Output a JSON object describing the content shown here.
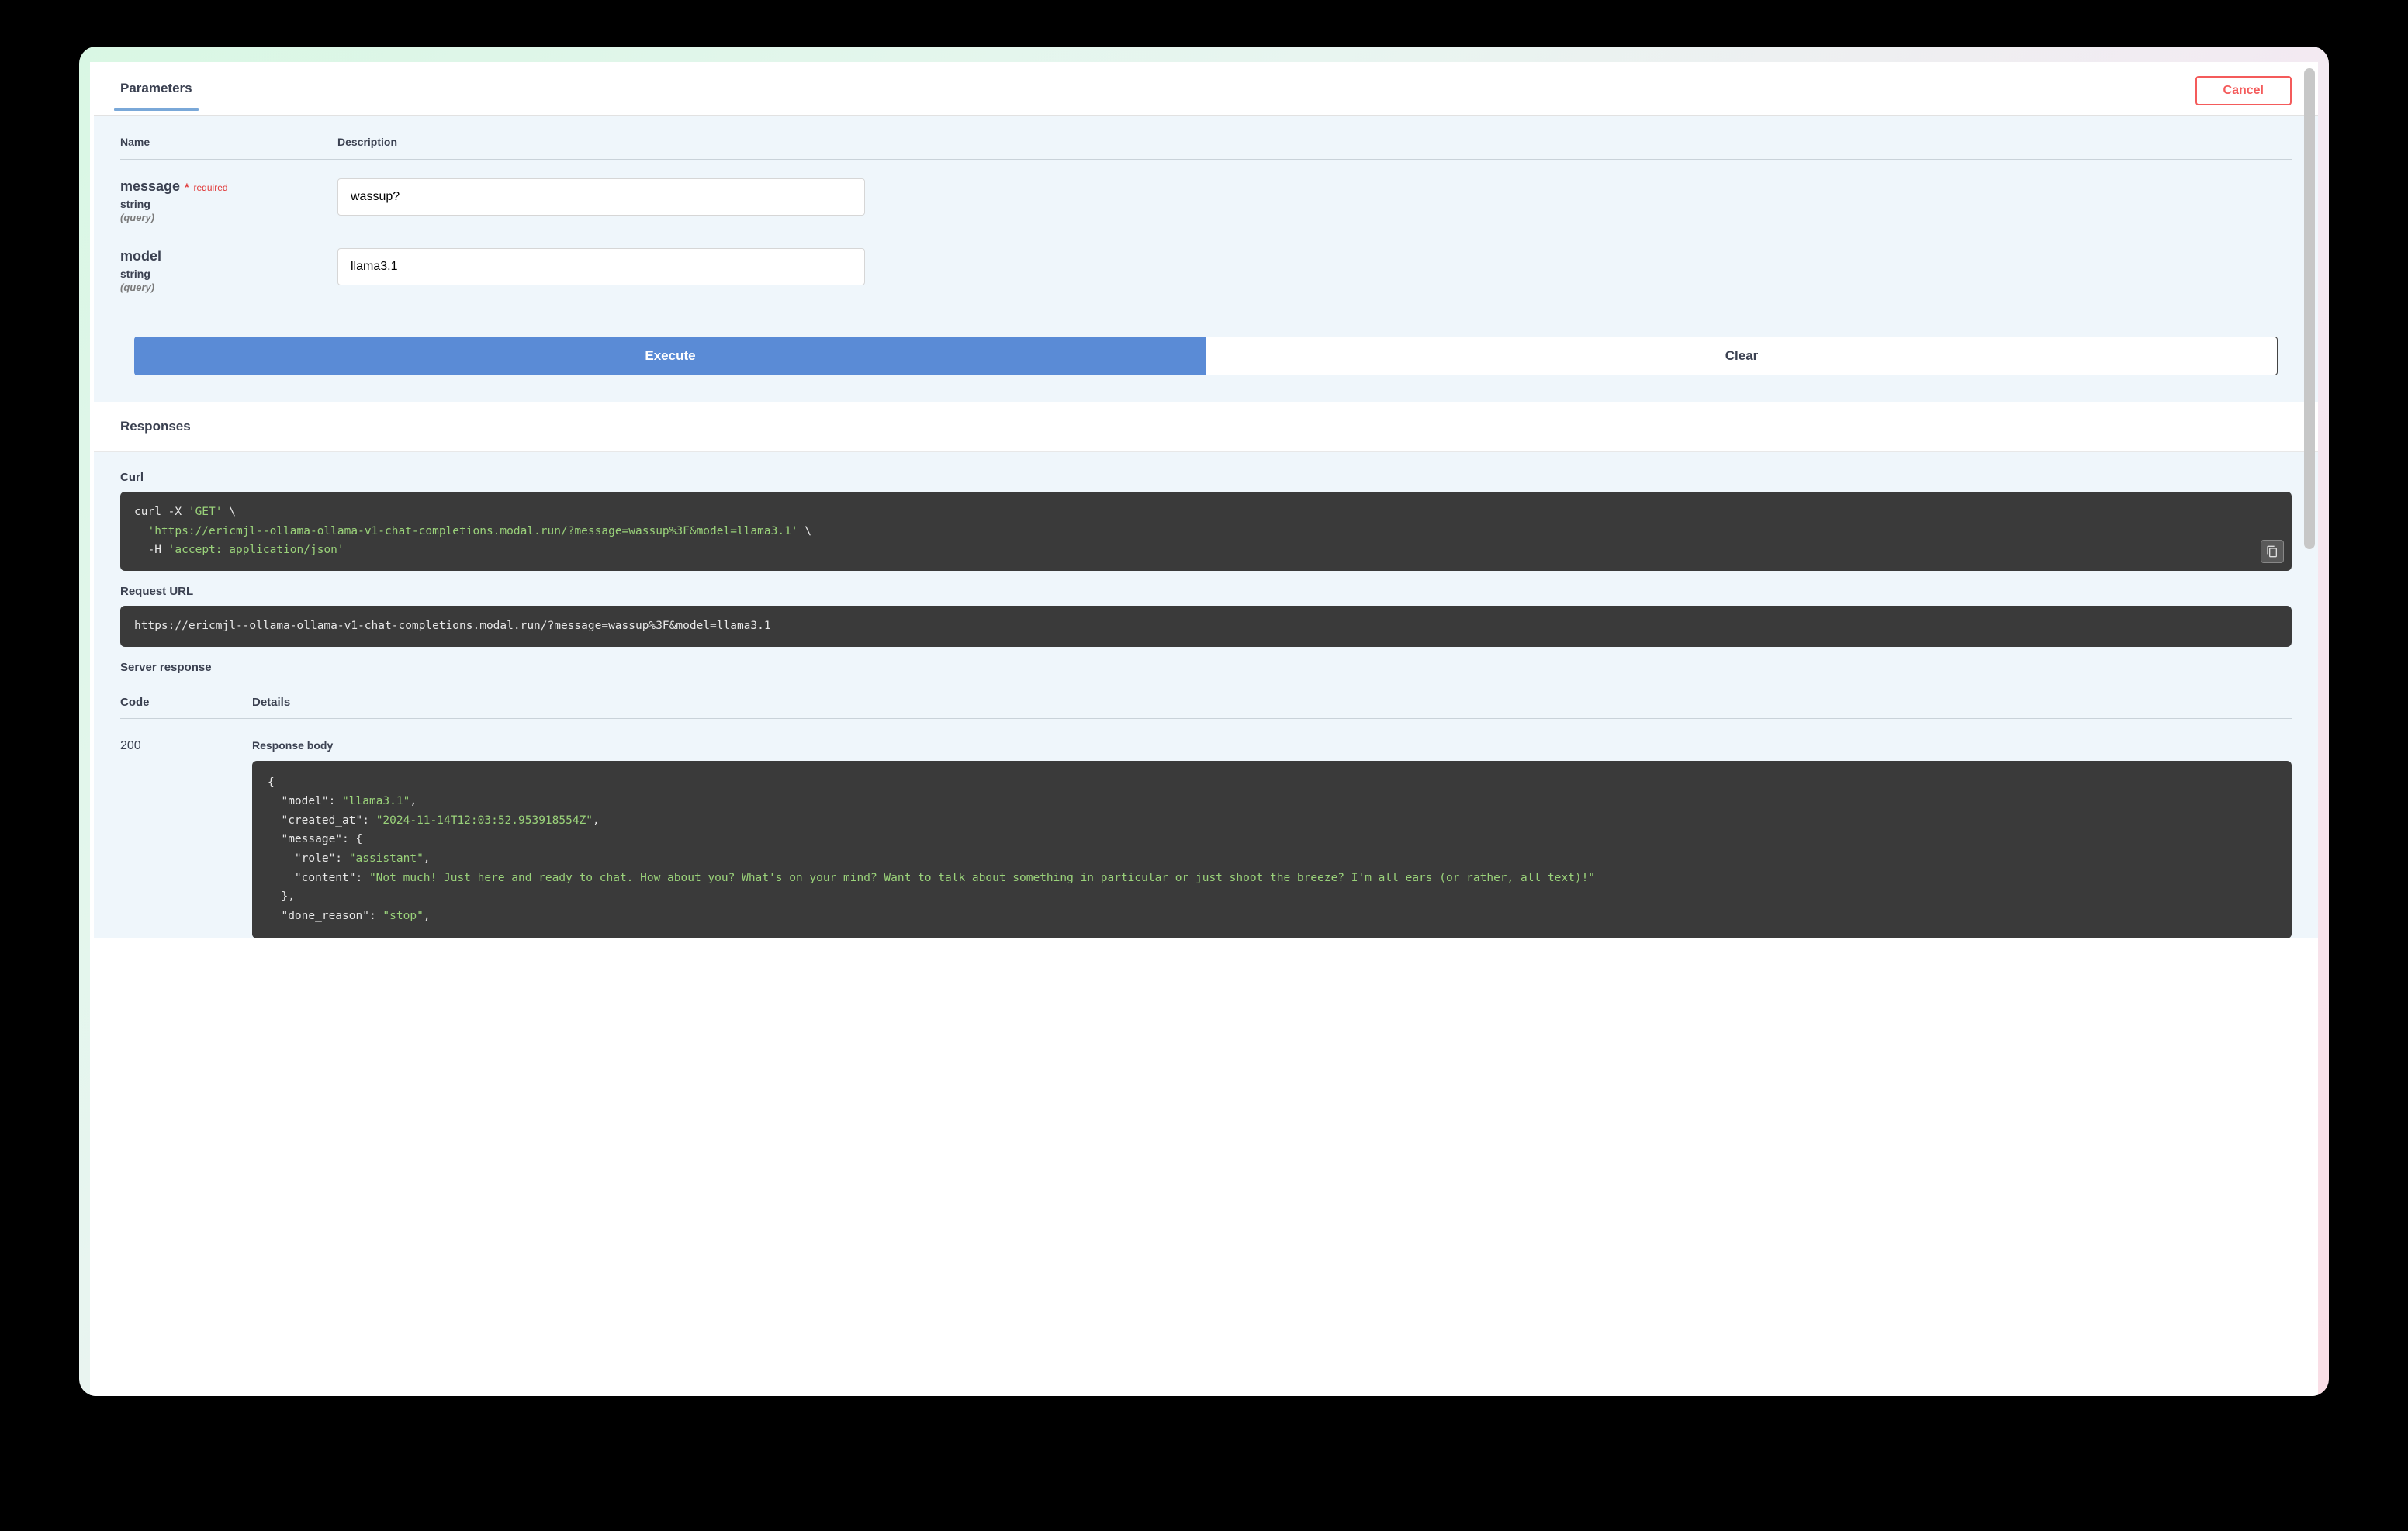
{
  "tabs": {
    "active": "Parameters"
  },
  "buttons": {
    "cancel": "Cancel",
    "execute": "Execute",
    "clear": "Clear"
  },
  "param_table": {
    "head_name": "Name",
    "head_desc": "Description"
  },
  "params": [
    {
      "name": "message",
      "required_label": "required",
      "type": "string",
      "in": "(query)",
      "value": "wassup?"
    },
    {
      "name": "model",
      "required_label": "",
      "type": "string",
      "in": "(query)",
      "value": "llama3.1"
    }
  ],
  "responses_header": "Responses",
  "curl": {
    "label": "Curl",
    "line1a": "curl -X ",
    "line1b": "'GET'",
    "line1c": " \\",
    "line2a": "  ",
    "line2b": "'https://ericmjl--ollama-ollama-v1-chat-completions.modal.run/?message=wassup%3F&model=llama3.1'",
    "line2c": " \\",
    "line3a": "  -H ",
    "line3b": "'accept: application/json'"
  },
  "request_url": {
    "label": "Request URL",
    "value": "https://ericmjl--ollama-ollama-v1-chat-completions.modal.run/?message=wassup%3F&model=llama3.1"
  },
  "server_response_label": "Server response",
  "resp_table": {
    "head_code": "Code",
    "head_details": "Details"
  },
  "response": {
    "code": "200",
    "body_label": "Response body",
    "json": {
      "l1": "{",
      "l2a": "  \"model\": ",
      "l2b": "\"llama3.1\"",
      "l2c": ",",
      "l3a": "  \"created_at\": ",
      "l3b": "\"2024-11-14T12:03:52.953918554Z\"",
      "l3c": ",",
      "l4": "  \"message\": {",
      "l5a": "    \"role\": ",
      "l5b": "\"assistant\"",
      "l5c": ",",
      "l6a": "    \"content\": ",
      "l6b": "\"Not much! Just here and ready to chat. How about you? What's on your mind? Want to talk about something in particular or just shoot the breeze? I'm all ears (or rather, all text)!\"",
      "l7": "  },",
      "l8a": "  \"done_reason\": ",
      "l8b": "\"stop\"",
      "l8c": ","
    }
  }
}
